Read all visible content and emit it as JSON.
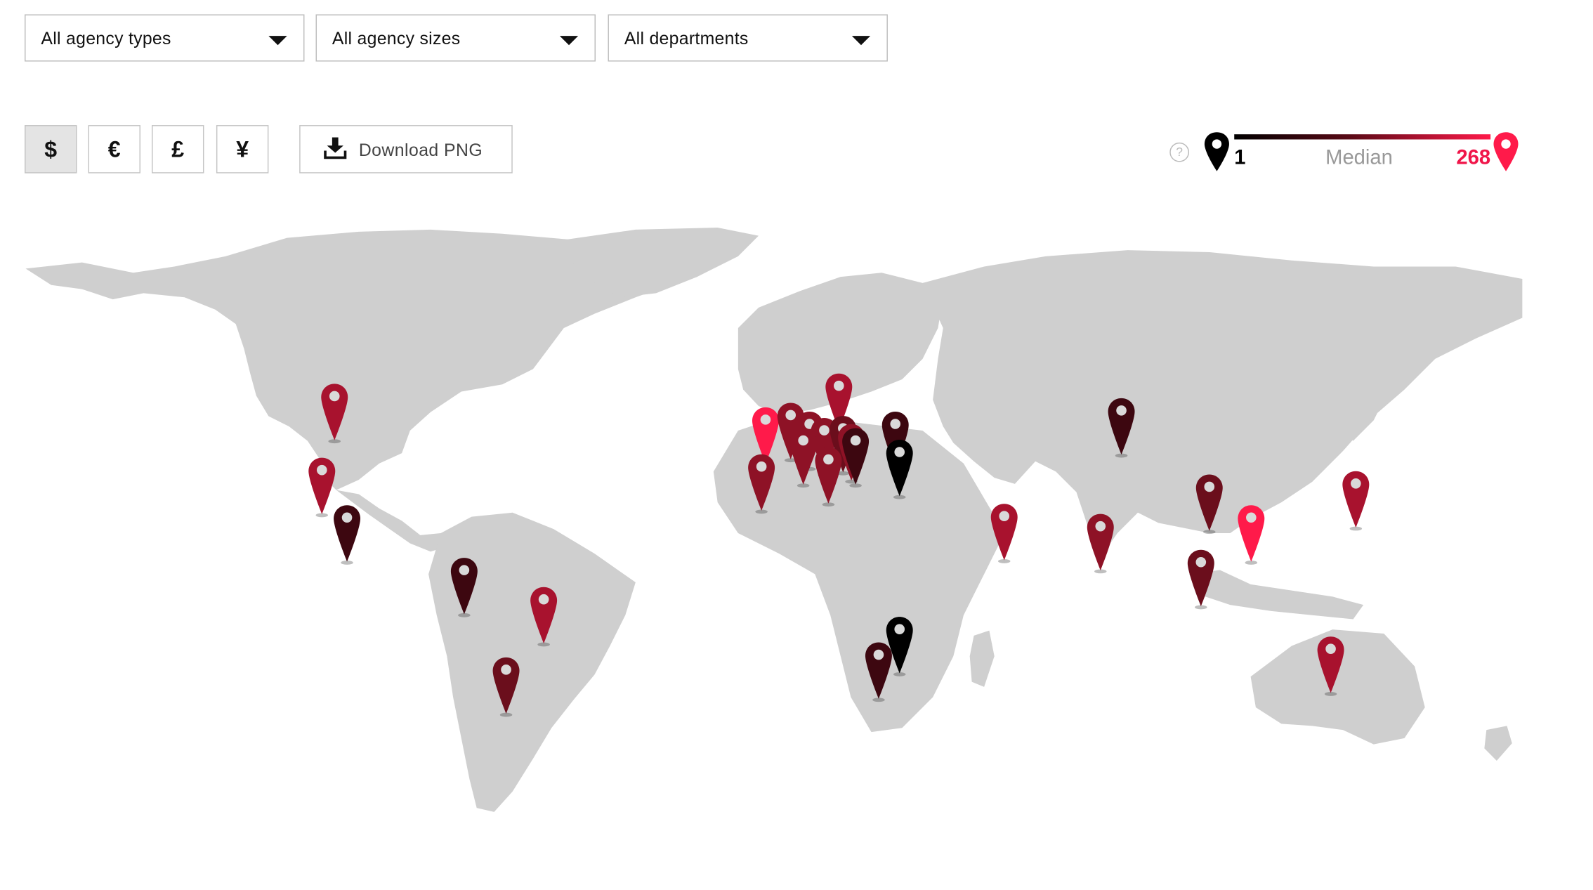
{
  "filters": {
    "agency_types": "All agency types",
    "agency_sizes": "All agency sizes",
    "departments": "All departments"
  },
  "currency": {
    "options": [
      "$",
      "€",
      "£",
      "¥"
    ],
    "selected": "$"
  },
  "download_label": "Download PNG",
  "legend": {
    "help": "?",
    "min": "1",
    "median": "Median",
    "max": "268",
    "color_min": "#000000",
    "color_max": "#ff1a4a"
  },
  "map": {
    "land_color": "#cfcfcf",
    "pin_icon": "map-marker-icon",
    "pin_color_scale": [
      "#000000",
      "#3d0710",
      "#6b0e1c",
      "#8e1226",
      "#a8122e",
      "#ff1a4a"
    ],
    "pins": [
      {
        "lat": 58.0,
        "lon": -105.0,
        "level": 4
      },
      {
        "lat": 40.0,
        "lon": -108.0,
        "level": 4
      },
      {
        "lat": 25.0,
        "lon": -102.0,
        "level": 1
      },
      {
        "lat": 6.0,
        "lon": -74.0,
        "level": 1
      },
      {
        "lat": -5.0,
        "lon": -55.0,
        "level": 4
      },
      {
        "lat": -30.0,
        "lon": -64.0,
        "level": 2
      },
      {
        "lat": 53.0,
        "lon": -2.0,
        "level": 5
      },
      {
        "lat": 54.0,
        "lon": 4.0,
        "level": 3
      },
      {
        "lat": 52.0,
        "lon": 8.5,
        "level": 3
      },
      {
        "lat": 50.5,
        "lon": 12.0,
        "level": 3
      },
      {
        "lat": 60.0,
        "lon": 15.5,
        "level": 4
      },
      {
        "lat": 51.0,
        "lon": 16.5,
        "level": 2
      },
      {
        "lat": 49.0,
        "lon": 18.5,
        "level": 3
      },
      {
        "lat": 48.0,
        "lon": 19.5,
        "level": 1
      },
      {
        "lat": 52.0,
        "lon": 29.0,
        "level": 1
      },
      {
        "lat": 45.0,
        "lon": 30.0,
        "level": 0
      },
      {
        "lat": 48.0,
        "lon": 7.0,
        "level": 3
      },
      {
        "lat": 43.0,
        "lon": 13.0,
        "level": 3
      },
      {
        "lat": 41.0,
        "lon": -3.0,
        "level": 3
      },
      {
        "lat": 55.0,
        "lon": 83.0,
        "level": 1
      },
      {
        "lat": 35.0,
        "lon": 104.0,
        "level": 2
      },
      {
        "lat": 36.0,
        "lon": 139.0,
        "level": 4
      },
      {
        "lat": 25.0,
        "lon": 114.0,
        "level": 5
      },
      {
        "lat": 9.0,
        "lon": 102.0,
        "level": 2
      },
      {
        "lat": 25.5,
        "lon": 55.0,
        "level": 4
      },
      {
        "lat": 22.0,
        "lon": 78.0,
        "level": 3
      },
      {
        "lat": -16.0,
        "lon": 30.0,
        "level": 0
      },
      {
        "lat": -25.0,
        "lon": 25.0,
        "level": 1
      },
      {
        "lat": -23.0,
        "lon": 133.0,
        "level": 4
      }
    ]
  }
}
